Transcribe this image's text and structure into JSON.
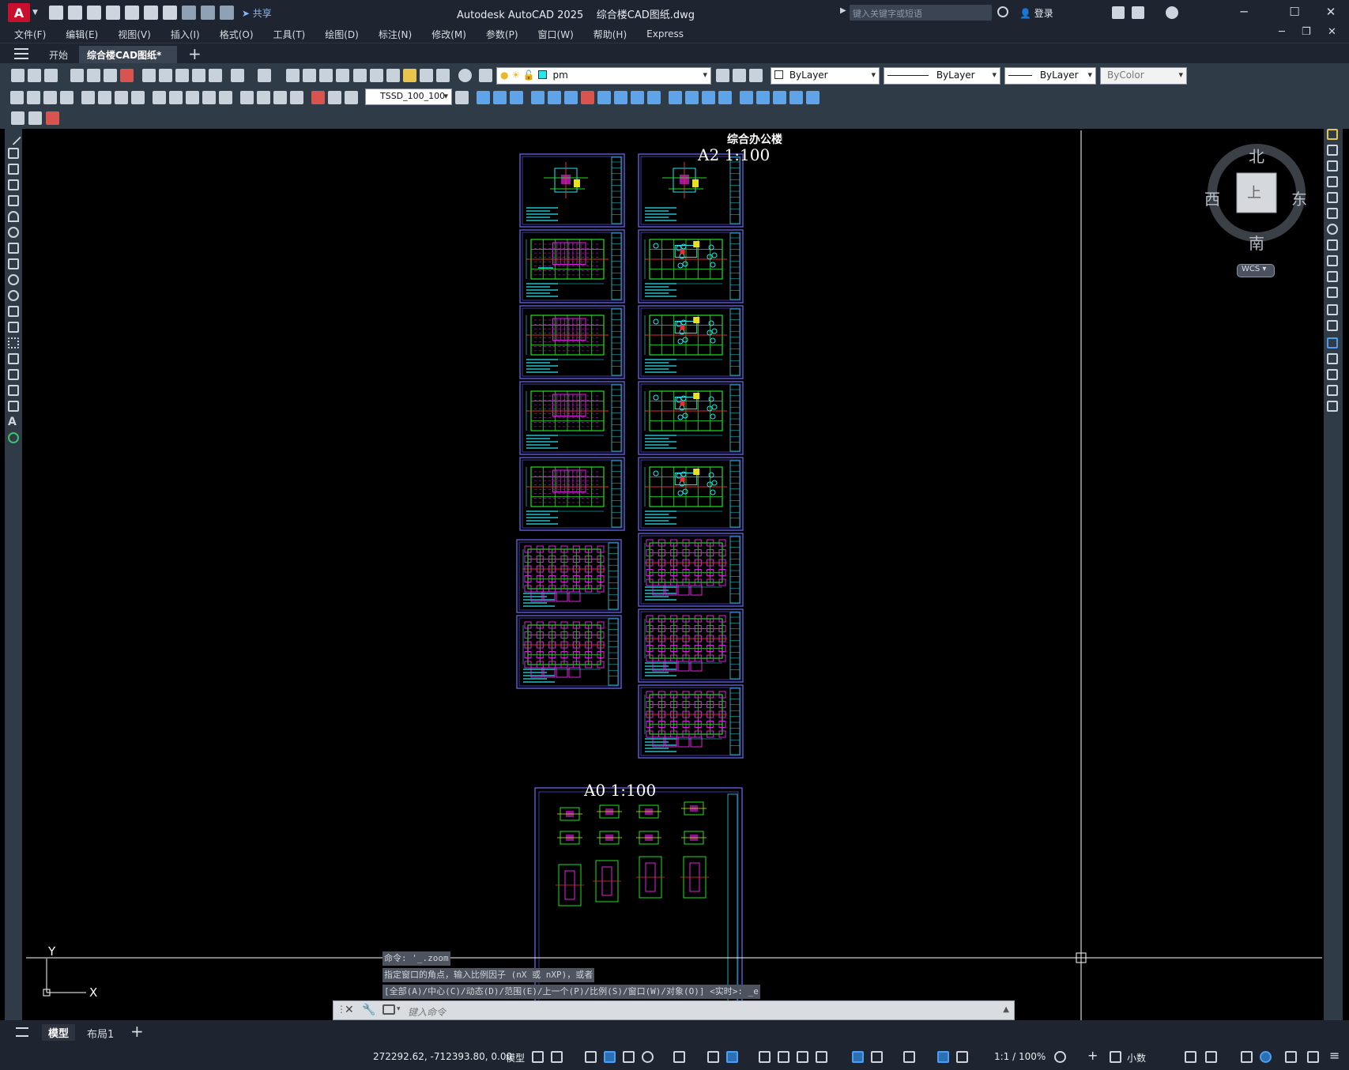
{
  "app": {
    "logo": "A",
    "title": "Autodesk AutoCAD 2025",
    "document": "综合楼CAD图纸.dwg",
    "share_label": "共享",
    "search_placeholder": "键入关键字或短语",
    "login_label": "登录"
  },
  "menu": [
    "文件(F)",
    "编辑(E)",
    "视图(V)",
    "插入(I)",
    "格式(O)",
    "工具(T)",
    "绘图(D)",
    "标注(N)",
    "修改(M)",
    "参数(P)",
    "窗口(W)",
    "帮助(H)",
    "Express"
  ],
  "tabs": {
    "start": "开始",
    "drawing": "综合楼CAD图纸*",
    "close": "×",
    "add": "+"
  },
  "toolbar": {
    "layer": "pm",
    "color": "ByLayer",
    "linetype": "ByLayer",
    "lineweight": "ByLayer",
    "plotstyle": "ByColor",
    "dimstyle": "TSSD_100_100",
    "layer_swatch_color": "#27e6ef"
  },
  "drawing": {
    "project_title": "综合办公楼",
    "upper_group_label": "A2 1:100",
    "lower_group_label": "A0 1:100",
    "ucs_y": "Y",
    "ucs_x": "X"
  },
  "viewcube": {
    "north": "北",
    "south": "南",
    "east": "东",
    "west": "西",
    "face": "上",
    "wcs": "WCS"
  },
  "command": {
    "history": [
      "命令: '_.zoom",
      "指定窗口的角点，输入比例因子 (nX 或 nXP)，或者",
      "[全部(A)/中心(C)/动态(D)/范围(E)/上一个(P)/比例(S)/窗口(W)/对象(O)] <实时>: _e"
    ],
    "placeholder": "键入命令"
  },
  "layout_tabs": {
    "model": "模型",
    "layout1": "布局1",
    "add": "+"
  },
  "status": {
    "coordinates": "272292.62, -712393.80, 0.00",
    "mode": "模型",
    "scale": "1:1 / 100%",
    "units": "小数"
  }
}
